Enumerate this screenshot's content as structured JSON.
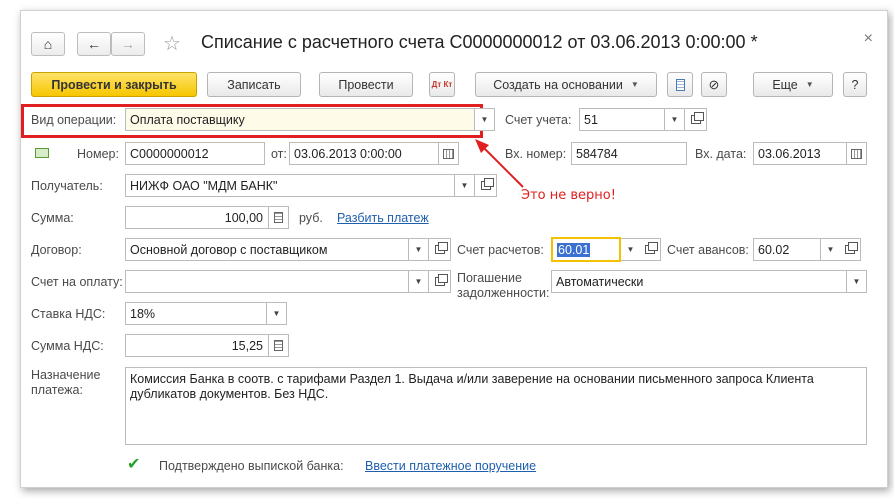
{
  "window": {
    "title": "Списание с расчетного счета С0000000012 от 03.06.2013 0:00:00 *"
  },
  "toolbar": {
    "post_close": "Провести и закрыть",
    "save": "Записать",
    "post": "Провести",
    "dtkt": "Дт Кт",
    "create_based": "Создать на основании",
    "more": "Еще",
    "help": "?"
  },
  "form": {
    "operation_type": {
      "label": "Вид операции:",
      "value": "Оплата поставщику"
    },
    "account": {
      "label": "Счет учета:",
      "value": "51"
    },
    "number": {
      "label": "Номер:",
      "value": "С0000000012"
    },
    "date": {
      "label": "от:",
      "value": "03.06.2013  0:00:00"
    },
    "in_number": {
      "label": "Вх. номер:",
      "value": "584784"
    },
    "in_date": {
      "label": "Вх. дата:",
      "value": "03.06.2013"
    },
    "recipient": {
      "label": "Получатель:",
      "value": "НИЖФ ОАО \"МДМ БАНК\""
    },
    "amount": {
      "label": "Сумма:",
      "value": "100,00",
      "currency": "руб.",
      "split_link": "Разбить платеж"
    },
    "contract": {
      "label": "Договор:",
      "value": "Основной договор с поставщиком"
    },
    "settle_account": {
      "label": "Счет расчетов:",
      "value": "60.01"
    },
    "advance_account": {
      "label": "Счет авансов:",
      "value": "60.02"
    },
    "invoice": {
      "label": "Счет на оплату:",
      "value": ""
    },
    "debt_repay": {
      "label_line1": "Погашение",
      "label_line2": "задолженности:",
      "value": "Автоматически"
    },
    "vat_rate": {
      "label": "Ставка НДС:",
      "value": "18%"
    },
    "vat_amount": {
      "label": "Сумма НДС:",
      "value": "15,25"
    },
    "purpose": {
      "label_line1": "Назначение",
      "label_line2": "платежа:",
      "value": "Комиссия Банка в соотв. с тарифами Раздел 1. Выдача и/или заверение на основании письменного запроса Клиента дубликатов документов. Без НДС."
    },
    "confirmed": {
      "label": "Подтверждено выпиской банка:",
      "checked": true,
      "link": "Ввести платежное поручение"
    }
  },
  "annotation": {
    "text": "Это не верно!",
    "color": "#e02020"
  },
  "colors": {
    "primary_button": "#f6c600",
    "highlight": "#e02020",
    "link": "#1f5fae",
    "focus": "#f2c100"
  }
}
